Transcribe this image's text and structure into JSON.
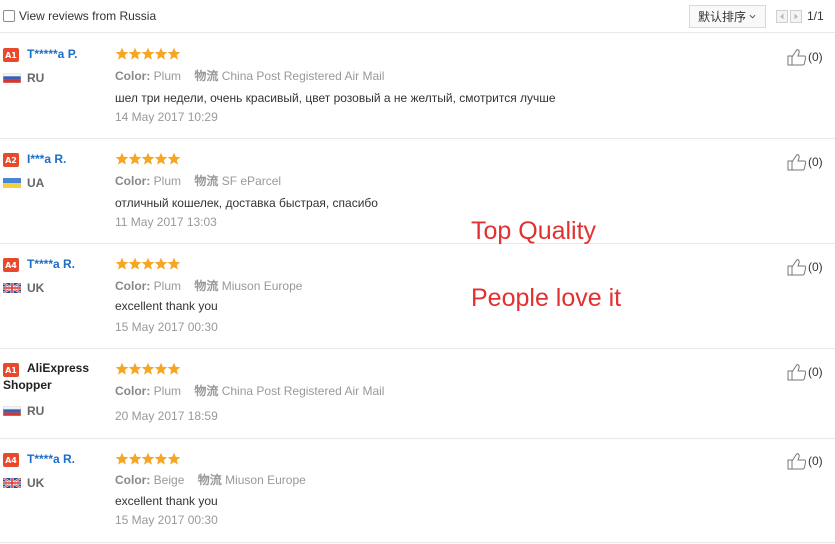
{
  "toolbar": {
    "filter_label": "View reviews from Russia",
    "sort_label": "默认排序",
    "page_indicator": "1/1"
  },
  "reviews": [
    {
      "level": "A1",
      "name": "T*****a P.",
      "country": "RU",
      "flag": "ru",
      "stars": 5,
      "color_label": "Color:",
      "color": "Plum",
      "ship_label": "物流",
      "shipping": "China Post Registered Air Mail",
      "text": "шел три недели, очень красивый, цвет розовый а не желтый, смотрится лучше",
      "date": "14 May 2017 10:29",
      "likes": "(0)"
    },
    {
      "level": "A2",
      "name": "I***a R.",
      "country": "UA",
      "flag": "ua",
      "stars": 5,
      "color_label": "Color:",
      "color": "Plum",
      "ship_label": "物流",
      "shipping": "SF eParcel",
      "text": "отличный кошелек, доставка быстрая, спасибо",
      "date": "11 May 2017 13:03",
      "likes": "(0)"
    },
    {
      "level": "A4",
      "name": "T****a R.",
      "country": "UK",
      "flag": "uk",
      "stars": 5,
      "color_label": "Color:",
      "color": "Plum",
      "ship_label": "物流",
      "shipping": "Miuson Europe",
      "text": "excellent thank you",
      "date": "15 May 2017 00:30",
      "likes": "(0)"
    },
    {
      "level": "A1",
      "name_line1": "AliExpress",
      "name_line2": "Shopper",
      "country": "RU",
      "flag": "ru",
      "stars": 5,
      "color_label": "Color:",
      "color": "Plum",
      "ship_label": "物流",
      "shipping": "China Post Registered Air Mail",
      "date": "20 May 2017 18:59",
      "likes": "(0)"
    },
    {
      "level": "A4",
      "name": "T****a R.",
      "country": "UK",
      "flag": "uk",
      "stars": 5,
      "color_label": "Color:",
      "color": "Beige",
      "ship_label": "物流",
      "shipping": "Miuson Europe",
      "text": "excellent thank you",
      "date": "15 May 2017 00:30",
      "likes": "(0)"
    }
  ],
  "overlay": {
    "line1": "Top Quality",
    "line2": "People love it"
  },
  "colors": {
    "username": "#1a6ec7",
    "level_badge": "#e8492c",
    "star": "#f6a623",
    "overlay_text": "#e33030"
  },
  "icons": [
    "checkbox-icon",
    "chevron-down-icon",
    "prev-page-icon",
    "next-page-icon",
    "star-icon",
    "flag-icon",
    "thumbs-up-icon"
  ]
}
